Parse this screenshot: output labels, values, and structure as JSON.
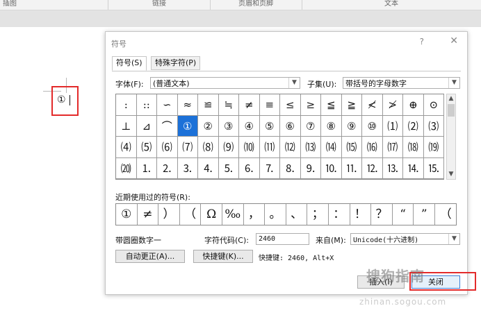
{
  "ribbon": {
    "groups": [
      "插图",
      "链接",
      "页眉和页脚",
      "文本"
    ]
  },
  "document": {
    "inserted_char": "①"
  },
  "dialog": {
    "title": "符号",
    "help": "?",
    "close": "✕",
    "tabs": [
      "符号(S)",
      "特殊字符(P)"
    ],
    "font_label": "字体(F):",
    "font_value": "(普通文本)",
    "subset_label": "子集(U):",
    "subset_value": "带括号的字母数字",
    "grid": [
      [
        ":",
        "::",
        "∽",
        "≈",
        "≌",
        "≒",
        "≠",
        "≡",
        "≤",
        "≥",
        "≦",
        "≧",
        "≮",
        "≯",
        "⊕",
        "⊙"
      ],
      [
        "⊥",
        "⊿",
        "⌒",
        "①",
        "②",
        "③",
        "④",
        "⑤",
        "⑥",
        "⑦",
        "⑧",
        "⑨",
        "⑩",
        "⑴",
        "⑵",
        "⑶"
      ],
      [
        "⑷",
        "⑸",
        "⑹",
        "⑺",
        "⑻",
        "⑼",
        "⑽",
        "⑾",
        "⑿",
        "⒀",
        "⒁",
        "⒂",
        "⒃",
        "⒄",
        "⒅",
        "⒆"
      ],
      [
        "⒇",
        "⒈",
        "⒉",
        "⒊",
        "⒋",
        "⒌",
        "⒍",
        "⒎",
        "⒏",
        "⒐",
        "⒑",
        "⒒",
        "⒓",
        "⒔",
        "⒕",
        "⒖"
      ]
    ],
    "selected": {
      "row": 1,
      "col": 3
    },
    "recent_label": "近期使用过的符号(R):",
    "recent": [
      "①",
      "≠",
      "）",
      "（",
      "Ω",
      "‰",
      "，",
      "。",
      "、",
      "；",
      "：",
      "！",
      "？",
      "“",
      "”",
      "（"
    ],
    "char_name": "带圆圈数字一",
    "char_code_label": "字符代码(C):",
    "char_code_value": "2460",
    "from_label": "来自(M):",
    "from_value": "Unicode(十六进制)",
    "autocorrect_button": "自动更正(A)...",
    "shortcut_key_button": "快捷键(K)...",
    "shortcut_text": "快捷键: 2460, Alt+X",
    "insert_button": "插入(I)",
    "close_button": "关闭"
  },
  "watermark": {
    "text": "搜狗指南",
    "url": "zhinan.sogou.com"
  },
  "colors": {
    "highlight": "#e32a2a",
    "selection": "#1c71d8"
  }
}
